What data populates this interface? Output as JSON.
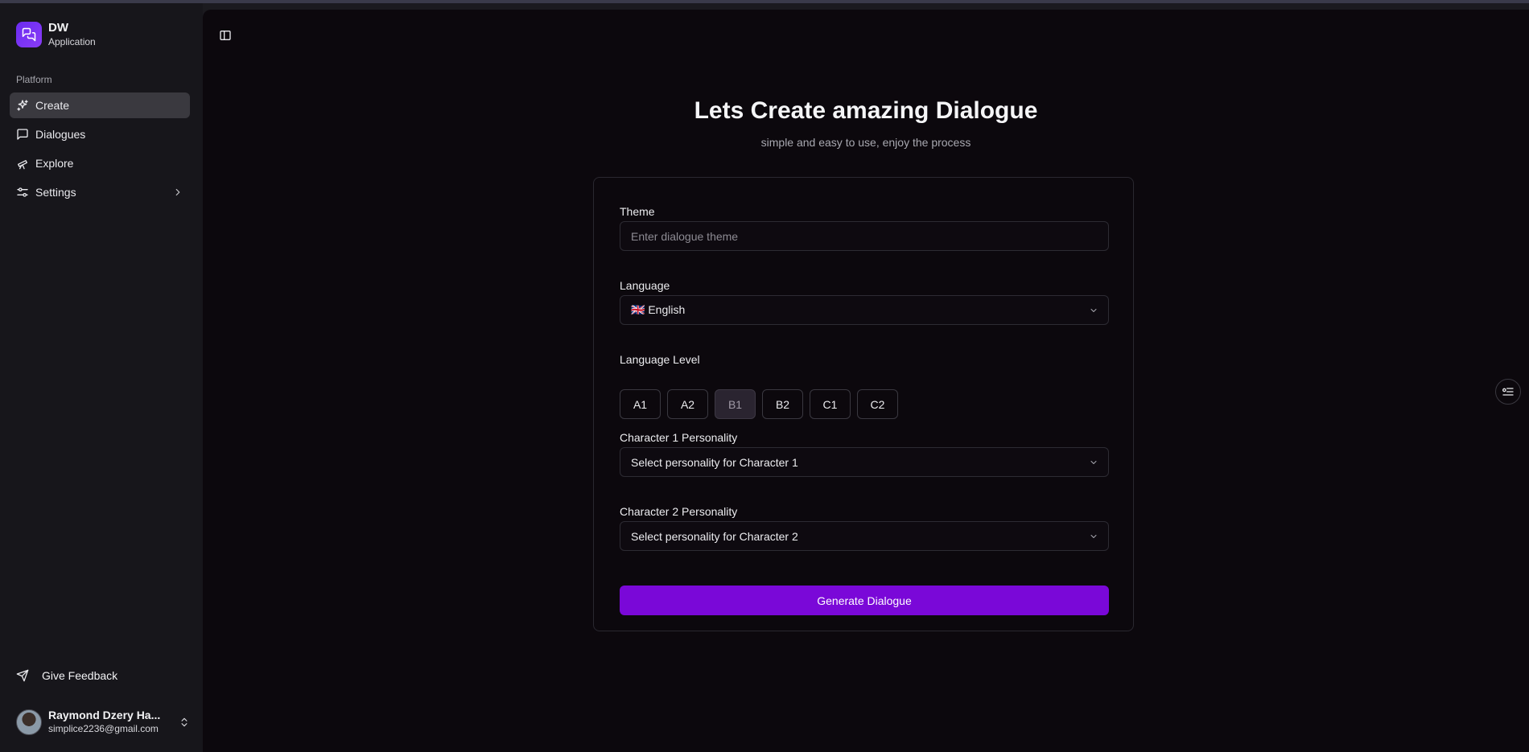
{
  "app": {
    "name": "DW",
    "subtitle": "Application"
  },
  "sidebar": {
    "group_label": "Platform",
    "items": [
      {
        "label": "Create",
        "icon": "sparkles-icon",
        "active": true
      },
      {
        "label": "Dialogues",
        "icon": "message-square-icon"
      },
      {
        "label": "Explore",
        "icon": "telescope-icon"
      },
      {
        "label": "Settings",
        "icon": "sliders-icon",
        "has_submenu": true
      }
    ],
    "feedback_label": "Give Feedback"
  },
  "user": {
    "name": "Raymond Dzery Ha...",
    "email": "simplice2236@gmail.com"
  },
  "main": {
    "title": "Lets Create amazing Dialogue",
    "subtitle": "simple and easy to use, enjoy the process",
    "form": {
      "theme_label": "Theme",
      "theme_placeholder": "Enter dialogue theme",
      "language_label": "Language",
      "language_value": "🇬🇧 English",
      "level_label": "Language Level",
      "levels": [
        "A1",
        "A2",
        "B1",
        "B2",
        "C1",
        "C2"
      ],
      "selected_level": "B1",
      "char1_label": "Character 1 Personality",
      "char1_placeholder": "Select personality for Character 1",
      "char2_label": "Character 2 Personality",
      "char2_placeholder": "Select personality for Character 2",
      "submit_label": "Generate Dialogue"
    }
  },
  "colors": {
    "accent": "#7a08d8",
    "main_bg": "#0c080d",
    "sidebar_bg": "#17161b"
  }
}
